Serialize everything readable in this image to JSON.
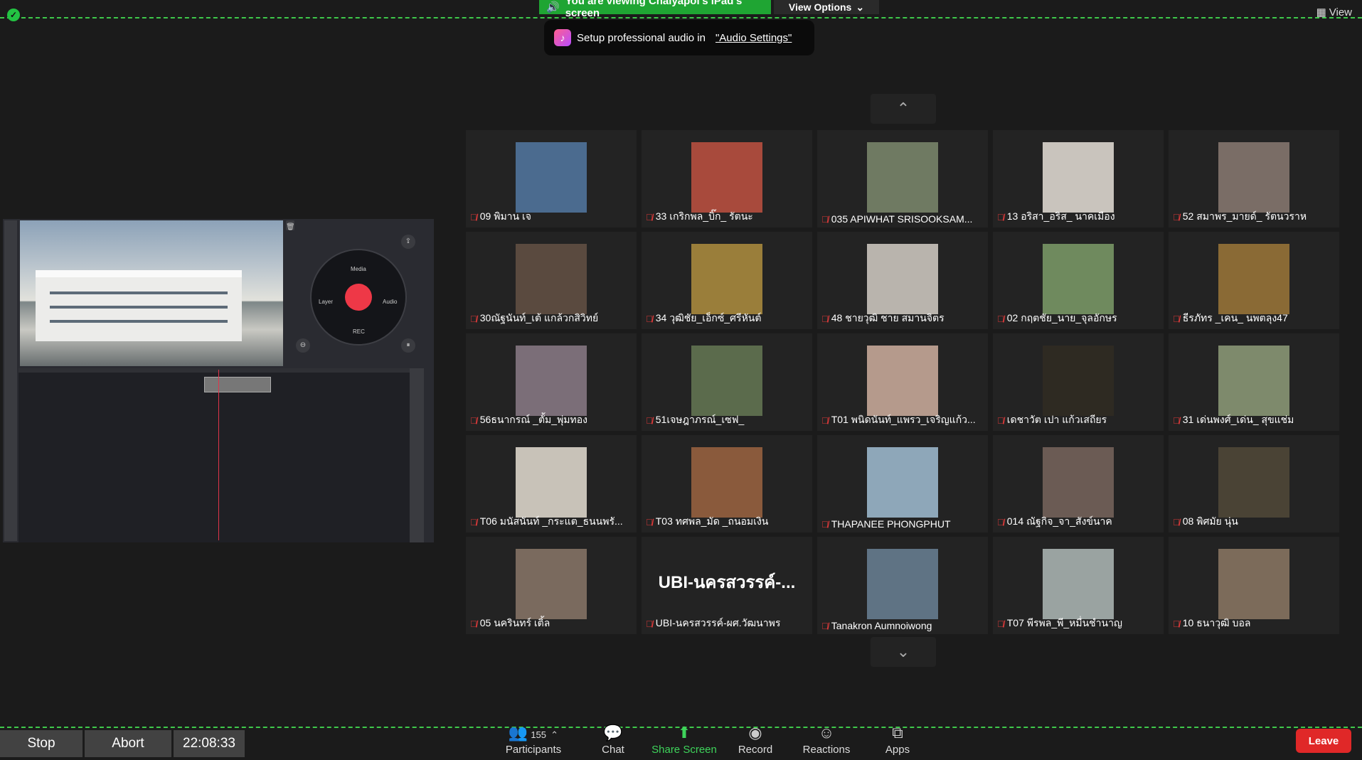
{
  "top": {
    "viewing_banner": "You are viewing Chaiyapol's iPad's screen",
    "view_options": "View Options",
    "view": "View",
    "audio_tip_text": "Setup professional audio in",
    "audio_tip_link": "\"Audio Settings\""
  },
  "share": {
    "wheel_labels": {
      "media": "Media",
      "layer": "Layer",
      "audio": "Audio",
      "rec": "REC"
    }
  },
  "participants": [
    {
      "name": "09 พิมาน เจ",
      "photo": "#4b6b8f"
    },
    {
      "name": "33 เกริกพล_บิ๊ก_ รัตนะ",
      "photo": "#a84a3c"
    },
    {
      "name": "035 APIWHAT SRISOOKSAM...",
      "photo": "#6f7a62"
    },
    {
      "name": "13 อริสา_อริส_ นาคเมือง",
      "photo": "#c9c4bd"
    },
    {
      "name": "52 สมาพร_มายด์_ รัตนวราห",
      "photo": "#7a6d66"
    },
    {
      "name": "30ณัฐนันท์_เต้ แกล้วกสิวิทย์",
      "photo": "#5a4a3f"
    },
    {
      "name": "34 วุฒิชัย_เอ็กซ์_ศรีหันต์",
      "photo": "#9a7e3a"
    },
    {
      "name": "48 ชายวุฒิ ชาย สมานจิตร",
      "photo": "#b9b4ad"
    },
    {
      "name": "02 กฤตชัย_นาย_จุลอักษร",
      "photo": "#6f8a5e"
    },
    {
      "name": "ธีรภัทร _เคน_ นพตลุง47",
      "photo": "#8a6a35"
    },
    {
      "name": "56ธนากรณ์ _ตั้ม_พุ่มทอง",
      "photo": "#7b6e78"
    },
    {
      "name": "51เจษฎาภรณ์_เซฟ_",
      "photo": "#5b6b4c"
    },
    {
      "name": "T01 พนิดนันท์_แพรว_เจริญแก้ว...",
      "photo": "#b59a8c"
    },
    {
      "name": "เดชาวัต เปา แก้วเสถียร",
      "photo": "#2e2a22"
    },
    {
      "name": "31 เด่นพงศ์_เด่น_ สุขแช่ม",
      "photo": "#7e8a6c"
    },
    {
      "name": "T06 มนัสนันท์ _กระแต_ธนนพรั...",
      "photo": "#c8c2b8"
    },
    {
      "name": "T03 ทศพล_มัด _ถนอมเงิน",
      "photo": "#8a5a3c"
    },
    {
      "name": "THAPANEE PHONGPHUT",
      "photo": "#8ea7b9"
    },
    {
      "name": "014 ณัฐกิจ_จา_สังข์นาค",
      "photo": "#6b5b54"
    },
    {
      "name": "08 พิศมัย นุ่น",
      "photo": "#4a4335"
    },
    {
      "name": "05 นครินทร์ เติ้ล",
      "photo": "#7a6a5e"
    },
    {
      "name": "UBI-นครสวรรค์-ผศ.วัฒนาพร",
      "big": "UBI-นครสวรรค์-...",
      "photo": ""
    },
    {
      "name": "Tanakron Aumnoiwong",
      "photo": "#5f7384"
    },
    {
      "name": "T07 พีรพล_พี_หมื่นชำนาญ",
      "photo": "#9aa3a1"
    },
    {
      "name": "10 ธนาวุฒิ บอล",
      "photo": "#7c6b5a"
    }
  ],
  "bottom": {
    "stop": "Stop",
    "abort": "Abort",
    "timer": "22:08:33",
    "participants_label": "Participants",
    "participants_count": "155",
    "chat": "Chat",
    "share_screen": "Share Screen",
    "record": "Record",
    "reactions": "Reactions",
    "apps": "Apps",
    "leave": "Leave"
  },
  "colors": {
    "accent_green": "#3ed45b",
    "leave_red": "#e02828",
    "muted_red": "#e03a3a"
  }
}
